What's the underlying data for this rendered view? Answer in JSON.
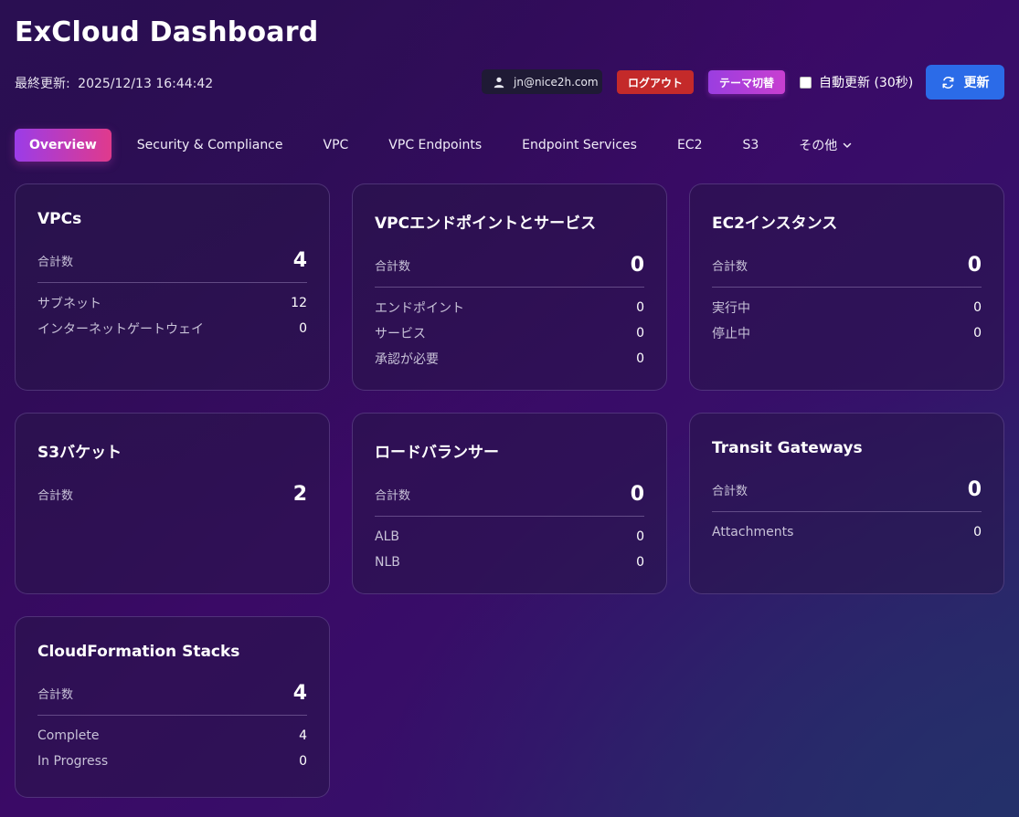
{
  "header": {
    "title": "ExCloud Dashboard",
    "updated_label": "最終更新:",
    "updated_value": "2025/12/13 16:44:42",
    "user_email": "jn@nice2h.com",
    "logout_label": "ログアウト",
    "theme_label": "テーマ切替",
    "auto_refresh_label": "自動更新 (30秒)",
    "auto_refresh_checked": false,
    "refresh_label": "更新"
  },
  "tabs": [
    {
      "label": "Overview",
      "active": true
    },
    {
      "label": "Security & Compliance"
    },
    {
      "label": "VPC"
    },
    {
      "label": "VPC Endpoints"
    },
    {
      "label": "Endpoint Services"
    },
    {
      "label": "EC2"
    },
    {
      "label": "S3"
    },
    {
      "label": "その他"
    }
  ],
  "cards": {
    "vpcs": {
      "title": "VPCs",
      "total_label": "合計数",
      "total": "4",
      "rows": [
        {
          "label": "サブネット",
          "value": "12"
        },
        {
          "label": "インターネットゲートウェイ",
          "value": "0"
        }
      ]
    },
    "endpoints": {
      "title": "VPCエンドポイントとサービス",
      "total_label": "合計数",
      "total": "0",
      "rows": [
        {
          "label": "エンドポイント",
          "value": "0"
        },
        {
          "label": "サービス",
          "value": "0"
        },
        {
          "label": "承認が必要",
          "value": "0"
        }
      ]
    },
    "ec2": {
      "title": "EC2インスタンス",
      "total_label": "合計数",
      "total": "0",
      "rows": [
        {
          "label": "実行中",
          "value": "0"
        },
        {
          "label": "停止中",
          "value": "0"
        }
      ]
    },
    "s3": {
      "title": "S3バケット",
      "total_label": "合計数",
      "total": "2"
    },
    "lb": {
      "title": "ロードバランサー",
      "total_label": "合計数",
      "total": "0",
      "rows": [
        {
          "label": "ALB",
          "value": "0"
        },
        {
          "label": "NLB",
          "value": "0"
        }
      ]
    },
    "tgw": {
      "title": "Transit Gateways",
      "total_label": "合計数",
      "total": "0",
      "rows": [
        {
          "label": "Attachments",
          "value": "0"
        }
      ]
    },
    "cfn": {
      "title": "CloudFormation Stacks",
      "total_label": "合計数",
      "total": "4",
      "rows": [
        {
          "label": "Complete",
          "value": "4"
        },
        {
          "label": "In Progress",
          "value": "0"
        }
      ]
    }
  },
  "icons": {
    "user": "user-icon",
    "refresh": "refresh-icon",
    "chevron": "chevron-down-icon"
  },
  "colors": {
    "logout": "#c42a2a",
    "refresh": "#2b6be8",
    "tab_active_start": "#9b3ce8",
    "tab_active_end": "#e03a8c"
  }
}
